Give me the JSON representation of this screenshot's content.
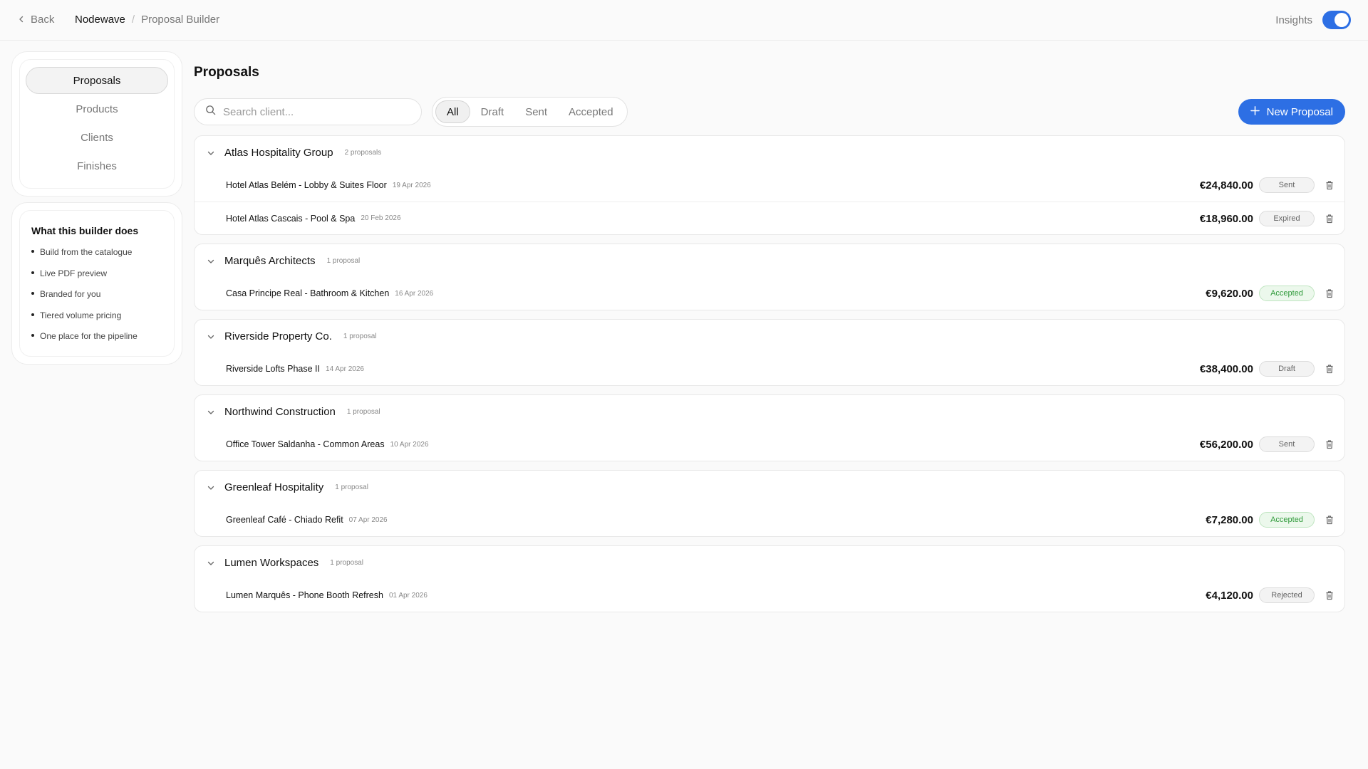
{
  "topbar": {
    "back_label": "Back",
    "breadcrumb": [
      "Nodewave",
      "/",
      "Proposal Builder"
    ],
    "insights_label": "Insights",
    "insights_on": true
  },
  "sidebar": {
    "nav": [
      {
        "label": "Proposals",
        "active": true
      },
      {
        "label": "Products",
        "active": false
      },
      {
        "label": "Clients",
        "active": false
      },
      {
        "label": "Finishes",
        "active": false
      }
    ],
    "info": {
      "title": "What this builder does",
      "items": [
        "Build from the catalogue",
        "Live PDF preview",
        "Branded for you",
        "Tiered volume pricing",
        "One place for the pipeline"
      ]
    }
  },
  "main": {
    "title": "Proposals",
    "search_placeholder": "Search client...",
    "filters": [
      {
        "label": "All",
        "active": true
      },
      {
        "label": "Draft",
        "active": false
      },
      {
        "label": "Sent",
        "active": false
      },
      {
        "label": "Accepted",
        "active": false
      }
    ],
    "new_button": "New Proposal",
    "groups": [
      {
        "name": "Atlas Hospitality Group",
        "count": "2 proposals",
        "rows": [
          {
            "name": "Hotel Atlas Belém - Lobby & Suites Floor",
            "date": "19 Apr 2026",
            "amount": "€24,840.00",
            "status": "Sent"
          },
          {
            "name": "Hotel Atlas Cascais - Pool & Spa",
            "date": "20 Feb 2026",
            "amount": "€18,960.00",
            "status": "Expired"
          }
        ]
      },
      {
        "name": "Marquês Architects",
        "count": "1 proposal",
        "rows": [
          {
            "name": "Casa Principe Real - Bathroom & Kitchen",
            "date": "16 Apr 2026",
            "amount": "€9,620.00",
            "status": "Accepted"
          }
        ]
      },
      {
        "name": "Riverside Property Co.",
        "count": "1 proposal",
        "rows": [
          {
            "name": "Riverside Lofts Phase II",
            "date": "14 Apr 2026",
            "amount": "€38,400.00",
            "status": "Draft"
          }
        ]
      },
      {
        "name": "Northwind Construction",
        "count": "1 proposal",
        "rows": [
          {
            "name": "Office Tower Saldanha - Common Areas",
            "date": "10 Apr 2026",
            "amount": "€56,200.00",
            "status": "Sent"
          }
        ]
      },
      {
        "name": "Greenleaf Hospitality",
        "count": "1 proposal",
        "rows": [
          {
            "name": "Greenleaf Café - Chiado Refit",
            "date": "07 Apr 2026",
            "amount": "€7,280.00",
            "status": "Accepted"
          }
        ]
      },
      {
        "name": "Lumen Workspaces",
        "count": "1 proposal",
        "rows": [
          {
            "name": "Lumen Marquês - Phone Booth Refresh",
            "date": "01 Apr 2026",
            "amount": "€4,120.00",
            "status": "Rejected"
          }
        ]
      }
    ]
  },
  "colors": {
    "accent": "#2d6fe4",
    "accepted_text": "#2f9a3a",
    "accepted_bg": "#ecf8ec"
  },
  "icons": {
    "back": "chevron-left-icon",
    "search": "search-icon",
    "new": "plus-icon",
    "group_toggle": "chevron-down-icon",
    "delete": "trash-icon"
  }
}
